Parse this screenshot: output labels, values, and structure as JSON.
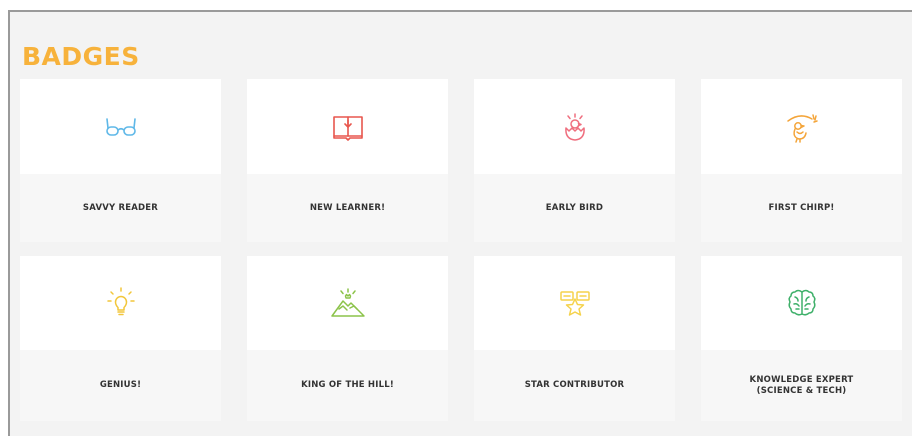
{
  "page": {
    "title": "BADGES"
  },
  "colors": {
    "title": "#f7b23b",
    "glasses": "#5fb8e8",
    "book": "#e8574e",
    "bird": "#ef6f7f",
    "chirp": "#f4a53a",
    "bulb": "#f2c63a",
    "mountain": "#8cc34a",
    "star": "#f5d24b",
    "brain": "#3fb06a"
  },
  "badges": [
    {
      "label": "SAVVY READER",
      "icon": "glasses-icon"
    },
    {
      "label": "NEW LEARNER!",
      "icon": "open-book-icon"
    },
    {
      "label": "EARLY BIRD",
      "icon": "hatching-chick-icon"
    },
    {
      "label": "FIRST CHIRP!",
      "icon": "chirping-bird-icon"
    },
    {
      "label": "GENIUS!",
      "icon": "lightbulb-icon"
    },
    {
      "label": "KING OF THE HILL!",
      "icon": "mountain-icon"
    },
    {
      "label": "STAR CONTRIBUTOR",
      "icon": "star-contributor-icon"
    },
    {
      "label": "KNOWLEDGE EXPERT\n(SCIENCE & TECH)",
      "icon": "brain-icon"
    }
  ]
}
